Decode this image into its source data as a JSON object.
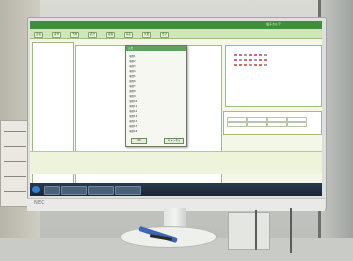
{
  "scene": {
    "description_type": "photo",
    "monitor_brand": "NEC",
    "screen_app_title": "",
    "user_area": "電子カルテ",
    "colors": {
      "header": "#3f8f3a",
      "toolbar": "#cfe6b8",
      "screen_bg": "#f4f7e7",
      "taskbar": "#1a2535"
    }
  },
  "toolbar": {
    "tabs": [
      "患者",
      "受付",
      "予約",
      "処方",
      "検査",
      "病名",
      "文書",
      "会計"
    ]
  },
  "dialog": {
    "title": "入力",
    "items": [
      "項目1",
      "項目2",
      "項目3",
      "項目4",
      "項目5",
      "項目6",
      "項目7",
      "項目8",
      "項目9",
      "項目10",
      "項目11",
      "項目12",
      "項目13",
      "項目14",
      "項目15",
      "項目16"
    ],
    "ok_label": "OK",
    "cancel_label": "キャンセル"
  },
  "info_bar": {
    "left_text": "",
    "mid_text": ""
  }
}
